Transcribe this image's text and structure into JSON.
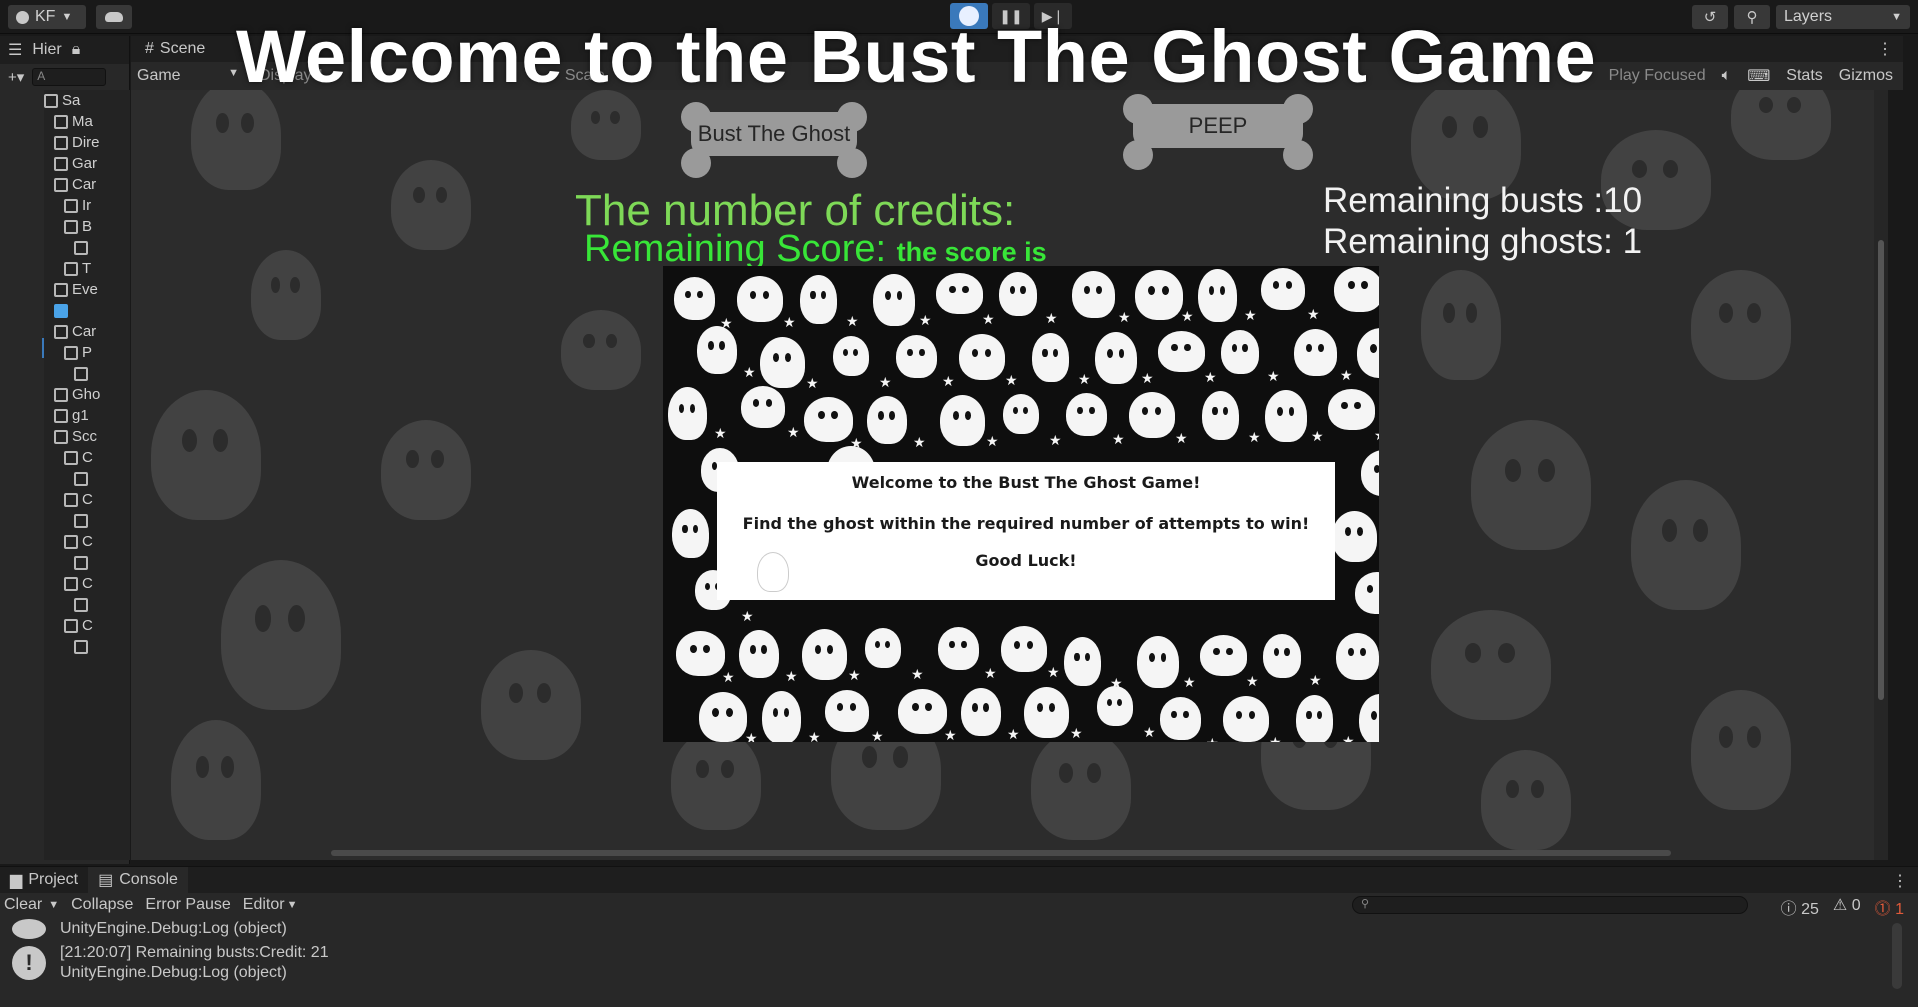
{
  "toolbar": {
    "account": "KF",
    "layers": "Layers"
  },
  "hierarchy": {
    "tab": "Hier",
    "search_placeholder": "A",
    "items": [
      "Sa",
      "Ma",
      "Dire",
      "Gar",
      "Car",
      "Ir",
      "B",
      "",
      "T",
      "Eve",
      "",
      "Car",
      "P",
      "",
      "Gho",
      "g1",
      "Scc",
      "C",
      "",
      "C",
      "",
      "C",
      "",
      "C",
      "",
      "C",
      ""
    ]
  },
  "view": {
    "scene_tab": "Scene",
    "game_label": "Game",
    "display": "Display 1",
    "scale": "Scale",
    "stats": "Stats",
    "gizmos": "Gizmos",
    "play_focused": "Play Focused"
  },
  "game": {
    "title": "Welcome to the Bust The Ghost Game",
    "bust_button": "Bust The Ghost",
    "peep_button": "PEEP",
    "credits_label": "The number of credits:",
    "score_label": "Remaining Score:",
    "score_value": "the score is",
    "remaining_busts": "Remaining busts :10",
    "remaining_ghosts": "Remaining ghosts: 1",
    "dialog": {
      "line1": "Welcome to the Bust The Ghost Game!",
      "line2": "Find the ghost within the required number of attempts to win!",
      "line3": "Good Luck!"
    }
  },
  "console": {
    "project_tab": "Project",
    "console_tab": "Console",
    "clear": "Clear",
    "collapse": "Collapse",
    "error_pause": "Error Pause",
    "editor": "Editor",
    "count_log": "25",
    "count_warn": "0",
    "count_err": "1",
    "logs": [
      {
        "line1": "",
        "line2": "UnityEngine.Debug:Log (object)"
      },
      {
        "line1": "[21:20:07] Remaining busts:Credit: 21",
        "line2": "UnityEngine.Debug:Log (object)"
      }
    ]
  }
}
